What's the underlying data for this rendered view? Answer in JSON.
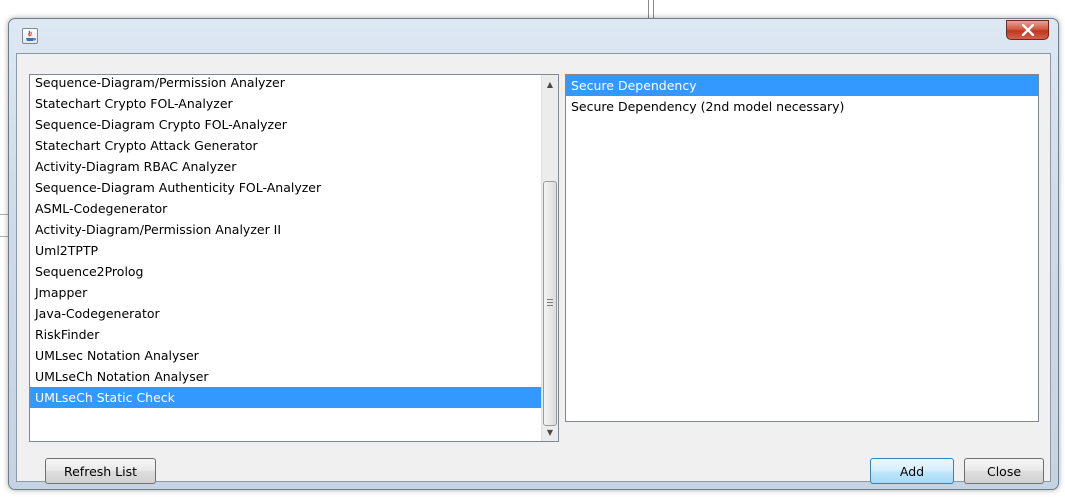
{
  "window": {
    "close_symbol": "X"
  },
  "left_list": {
    "items": [
      "Sequence-Diagram/Permission Analyzer",
      "Statechart Crypto FOL-Analyzer",
      "Sequence-Diagram Crypto FOL-Analyzer",
      "Statechart Crypto Attack Generator",
      "Activity-Diagram RBAC Analyzer",
      "Sequence-Diagram Authenticity FOL-Analyzer",
      "ASML-Codegenerator",
      "Activity-Diagram/Permission Analyzer II",
      "Uml2TPTP",
      "Sequence2Prolog",
      "Jmapper",
      "Java-Codegenerator",
      "RiskFinder",
      "UMLsec Notation Analyser",
      "UMLseCh Notation Analyser",
      "UMLseCh Static Check"
    ],
    "selected_index": 15
  },
  "right_list": {
    "items": [
      "Secure Dependency",
      "Secure Dependency (2nd model necessary)"
    ],
    "selected_index": 0
  },
  "buttons": {
    "refresh": "Refresh List",
    "add": "Add",
    "close": "Close"
  },
  "colors": {
    "selection": "#3399ff",
    "dialog_background": "#f0f0f0",
    "close_button": "#c7402a"
  }
}
